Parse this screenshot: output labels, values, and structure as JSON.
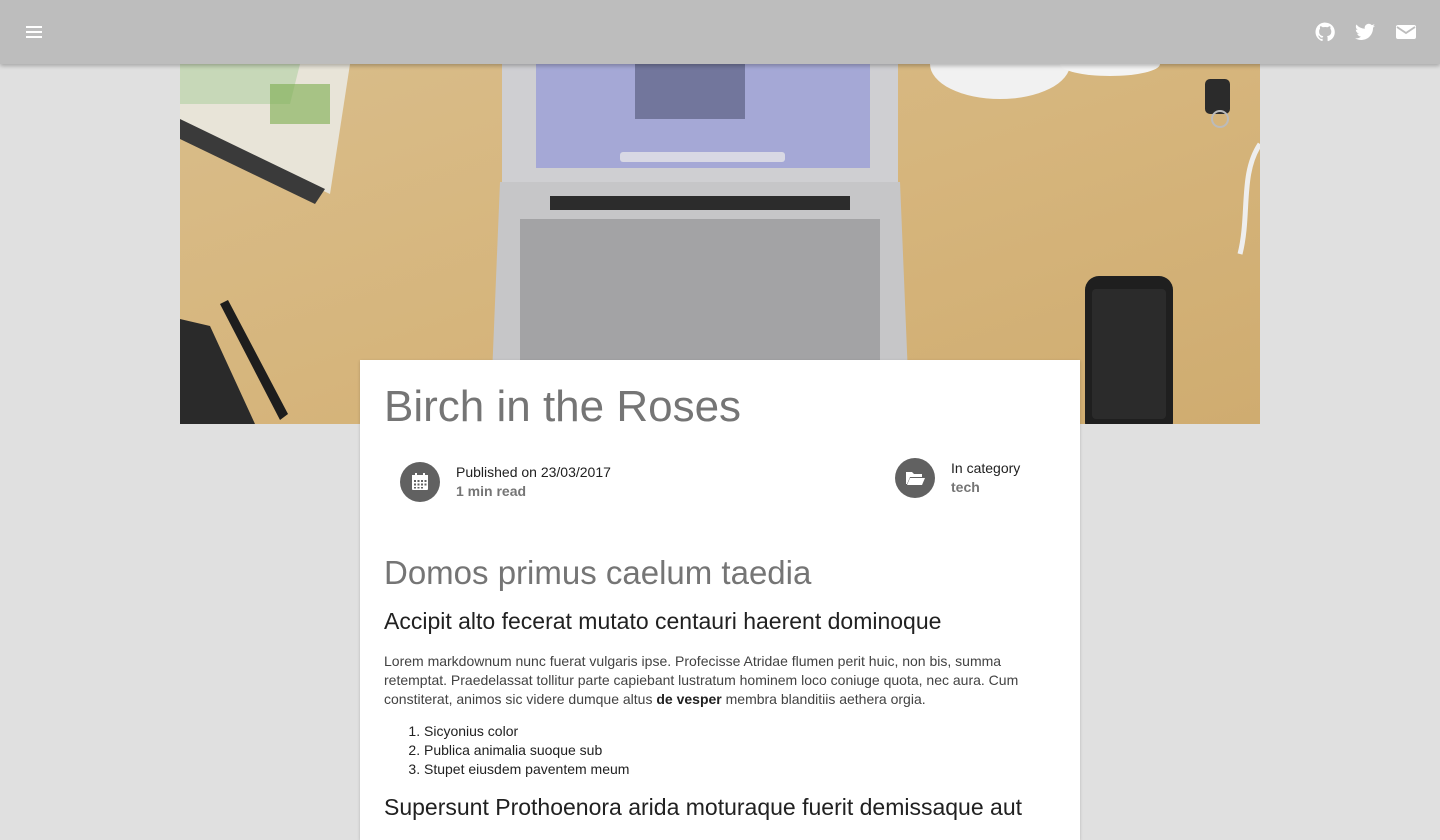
{
  "topbar": {
    "menu_icon": "hamburger-menu-icon",
    "actions": [
      "github-icon",
      "twitter-icon",
      "envelope-icon"
    ]
  },
  "post": {
    "title": "Birch in the Roses",
    "published_label": "Published on 23/03/2017",
    "read_time": "1 min read",
    "category_label": "In category",
    "category": "tech",
    "heading_h2": "Domos primus caelum taedia",
    "heading_h3": "Accipit alto fecerat mutato centauri haerent dominoque",
    "paragraph_before_bold": "Lorem markdownum nunc fuerat vulgaris ipse. Profecisse Atridae flumen perit huic, non bis, summa retemptat. Praedelassat tollitur parte capiebant lustratum hominem loco coniuge quota, nec aura. Cum constiterat, animos sic videre dumque altus ",
    "paragraph_bold": "de vesper",
    "paragraph_after_bold": " membra blanditiis aethera orgia.",
    "list": [
      "Sicyonius color",
      "Publica animalia suoque sub",
      "Stupet eiusdem paventem meum"
    ],
    "heading_h3_second": "Supersunt Prothoenora arida moturaque fuerit demissaque aut"
  },
  "colors": {
    "topbar": "#bdbdbd",
    "background": "#e0e0e0",
    "icon_circle": "#616161",
    "title": "#757575"
  }
}
